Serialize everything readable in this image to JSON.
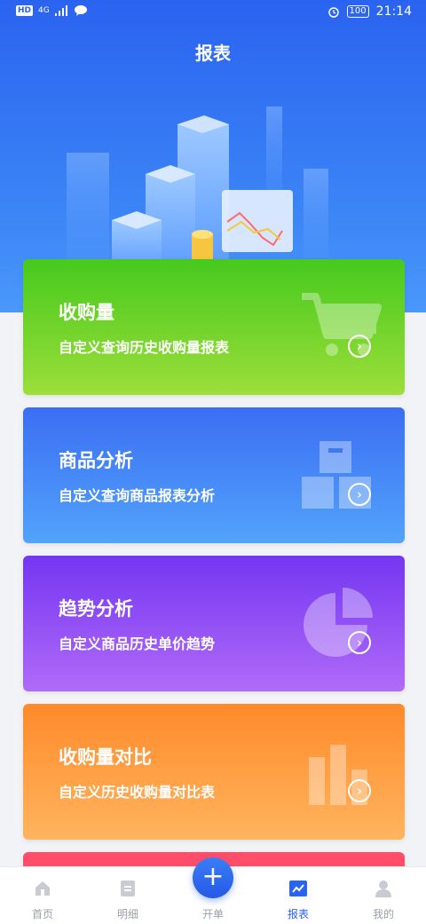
{
  "status_bar": {
    "left_badges": [
      "HD",
      "4G"
    ],
    "battery": "100",
    "time": "21:14"
  },
  "header": {
    "title": "报表"
  },
  "cards": [
    {
      "title": "收购量",
      "subtitle": "自定义查询历史收购量报表",
      "icon": "cart-icon",
      "color": "#46c91d"
    },
    {
      "title": "商品分析",
      "subtitle": "自定义查询商品报表分析",
      "icon": "boxes-icon",
      "color": "#3b6ef3"
    },
    {
      "title": "趋势分析",
      "subtitle": "自定义商品历史单价趋势",
      "icon": "pie-chart-icon",
      "color": "#7436f1"
    },
    {
      "title": "收购量对比",
      "subtitle": "自定义历史收购量对比表",
      "icon": "bar-chart-icon",
      "color": "#ff8a2a"
    }
  ],
  "tabbar": {
    "tabs": [
      {
        "label": "首页",
        "icon": "home-icon"
      },
      {
        "label": "明细",
        "icon": "document-icon"
      },
      {
        "label": "开单",
        "icon": "plus-icon"
      },
      {
        "label": "报表",
        "icon": "chart-icon"
      },
      {
        "label": "我的",
        "icon": "user-icon"
      }
    ],
    "active": "报表",
    "fab_symbol": "+"
  }
}
